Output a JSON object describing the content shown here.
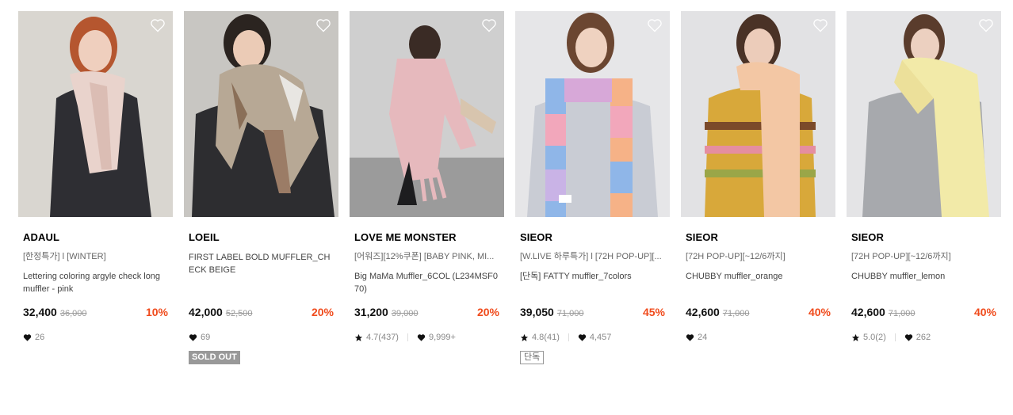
{
  "products": [
    {
      "brand": "ADAUL",
      "promo": "[한정특가] l [WINTER]",
      "name": "Lettering coloring argyle check long muffler - pink",
      "price": "32,400",
      "original_price": "36,000",
      "discount": "10%",
      "rating": "",
      "likes": "26",
      "badge": "",
      "bg": "#d9d6d0"
    },
    {
      "brand": "LOEIL",
      "promo": "",
      "name": "FIRST LABEL BOLD MUFFLER_CHECK BEIGE",
      "price": "42,000",
      "original_price": "52,500",
      "discount": "20%",
      "rating": "",
      "likes": "69",
      "badge": "SOLD OUT",
      "bg": "#c8c6c2"
    },
    {
      "brand": "LOVE ME MONSTER",
      "promo": "[어워즈][12%쿠폰] [BABY PINK, MI...",
      "name": "Big MaMa Muffler_6COL (L234MSF070)",
      "price": "31,200",
      "original_price": "39,000",
      "discount": "20%",
      "rating": "4.7(437)",
      "likes": "9,999+",
      "badge": "",
      "bg": "#cfcfcf"
    },
    {
      "brand": "SIEOR",
      "promo": "[W.LIVE 하루특가] l [72H POP-UP][...",
      "name": "[단독] FATTY muffler_7colors",
      "price": "39,050",
      "original_price": "71,000",
      "discount": "45%",
      "rating": "4.8(41)",
      "likes": "4,457",
      "badge": "단독",
      "bg": "#e6e6e8"
    },
    {
      "brand": "SIEOR",
      "promo": "[72H POP-UP][~12/6까지]",
      "name": "CHUBBY muffler_orange",
      "price": "42,600",
      "original_price": "71,000",
      "discount": "40%",
      "rating": "",
      "likes": "24",
      "badge": "",
      "bg": "#e2e2e4"
    },
    {
      "brand": "SIEOR",
      "promo": "[72H POP-UP][~12/6까지]",
      "name": "CHUBBY muffler_lemon",
      "price": "42,600",
      "original_price": "71,000",
      "discount": "40%",
      "rating": "5.0(2)",
      "likes": "262",
      "badge": "",
      "bg": "#e4e4e6"
    }
  ],
  "colors": {
    "discount": "#f04b1c",
    "sold_out_bg": "#999999"
  },
  "icons": {
    "favorite": "heart-outline-icon",
    "likes": "heart-icon",
    "rating": "star-icon"
  }
}
